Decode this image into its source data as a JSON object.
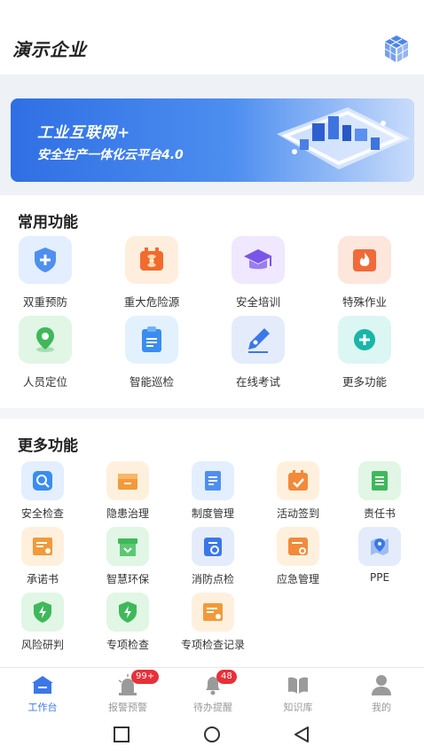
{
  "header": {
    "title": "演示企业",
    "icon": "cube-icon"
  },
  "banner": {
    "line1": "工业互联网+",
    "line2": "安全生产一体化云平台4.0"
  },
  "common": {
    "title": "常用功能",
    "items": [
      {
        "label": "双重预防",
        "icon": "shield-plus-icon",
        "color": "#4f8ff0",
        "bg": "#e3efff"
      },
      {
        "label": "重大危险源",
        "icon": "radiation-icon",
        "color": "#f26b2e",
        "bg": "#ffeedd"
      },
      {
        "label": "安全培训",
        "icon": "graduation-cap-icon",
        "color": "#7b55e8",
        "bg": "#efe8ff"
      },
      {
        "label": "特殊作业",
        "icon": "fire-icon",
        "color": "#f06a3a",
        "bg": "#fde6dc"
      },
      {
        "label": "人员定位",
        "icon": "location-pin-icon",
        "color": "#3fb85a",
        "bg": "#e1f6e5"
      },
      {
        "label": "智能巡检",
        "icon": "clipboard-icon",
        "color": "#3a8df0",
        "bg": "#e3f1ff"
      },
      {
        "label": "在线考试",
        "icon": "pen-nib-icon",
        "color": "#3a78e8",
        "bg": "#e4ecfb"
      },
      {
        "label": "更多功能",
        "icon": "plus-circle-icon",
        "color": "#19b6a8",
        "bg": "#dcf6f3"
      }
    ]
  },
  "more": {
    "title": "更多功能",
    "items": [
      {
        "label": "安全检查",
        "icon": "search-icon",
        "color": "#3a8df0",
        "bg": "#e3efff"
      },
      {
        "label": "隐患治理",
        "icon": "box-icon",
        "color": "#f29a3a",
        "bg": "#fff0de"
      },
      {
        "label": "制度管理",
        "icon": "document-icon",
        "color": "#4f8ff0",
        "bg": "#e3efff"
      },
      {
        "label": "活动签到",
        "icon": "calendar-check-icon",
        "color": "#f28a3a",
        "bg": "#fff0de"
      },
      {
        "label": "责任书",
        "icon": "document-list-icon",
        "color": "#3fb85a",
        "bg": "#e1f6e5"
      },
      {
        "label": "承诺书",
        "icon": "certificate-icon",
        "color": "#f29a3a",
        "bg": "#fff0de"
      },
      {
        "label": "智慧环保",
        "icon": "recycle-box-icon",
        "color": "#3fb85a",
        "bg": "#e1f6e5"
      },
      {
        "label": "消防点检",
        "icon": "clipboard-refresh-icon",
        "color": "#3a78e8",
        "bg": "#e4ecfb"
      },
      {
        "label": "应急管理",
        "icon": "emergency-card-icon",
        "color": "#f28a3a",
        "bg": "#fff0de"
      },
      {
        "label": "PPE",
        "icon": "map-pin-icon",
        "color": "#3a78e8",
        "bg": "#e4ecfb"
      },
      {
        "label": "风险研判",
        "icon": "shield-bolt-icon",
        "color": "#3fb85a",
        "bg": "#e1f6e5"
      },
      {
        "label": "专项检查",
        "icon": "shield-bolt-icon",
        "color": "#3fb85a",
        "bg": "#e1f6e5"
      },
      {
        "label": "专项检查记录",
        "icon": "certificate-icon",
        "color": "#f29a3a",
        "bg": "#fff0de"
      }
    ]
  },
  "tabbar": {
    "items": [
      {
        "label": "工作台",
        "icon": "home-icon",
        "active": true
      },
      {
        "label": "报警预警",
        "icon": "alarm-icon",
        "badge": "99+"
      },
      {
        "label": "待办提醒",
        "icon": "bell-icon",
        "badge": "48"
      },
      {
        "label": "知识库",
        "icon": "book-icon"
      },
      {
        "label": "我的",
        "icon": "user-icon"
      }
    ]
  },
  "accent": "#3a78e8"
}
